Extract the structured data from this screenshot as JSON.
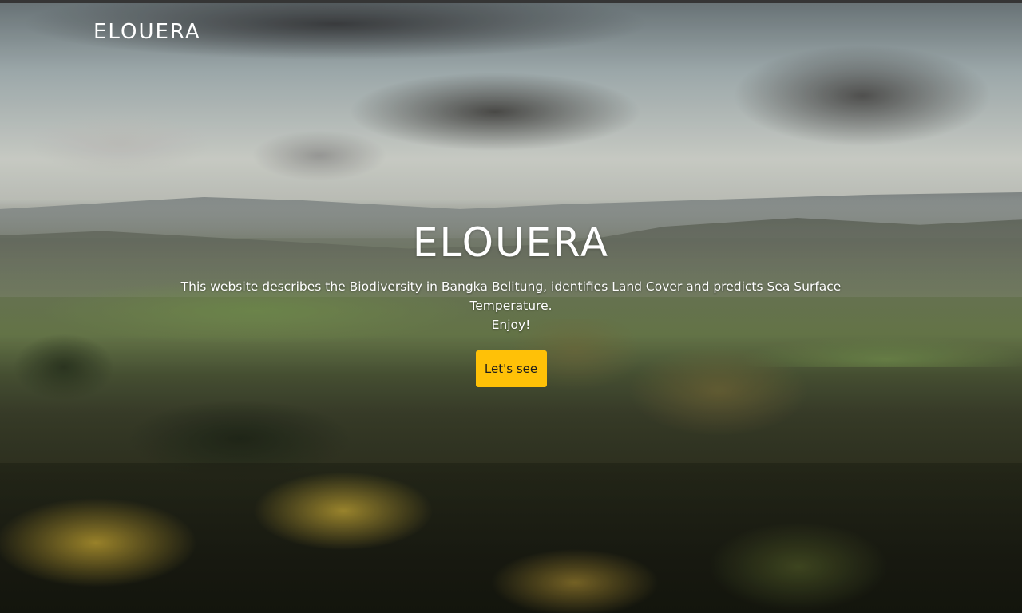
{
  "navbar": {
    "brand": "ELOUERA"
  },
  "hero": {
    "title": "ELOUERA",
    "description_line1": "This website describes the Biodiversity in Bangka Belitung, identifies Land Cover and predicts Sea Surface Temperature.",
    "description_line2": "Enjoy!",
    "cta_label": "Let's see"
  },
  "colors": {
    "cta_background": "#ffc107",
    "text": "#ffffff"
  }
}
